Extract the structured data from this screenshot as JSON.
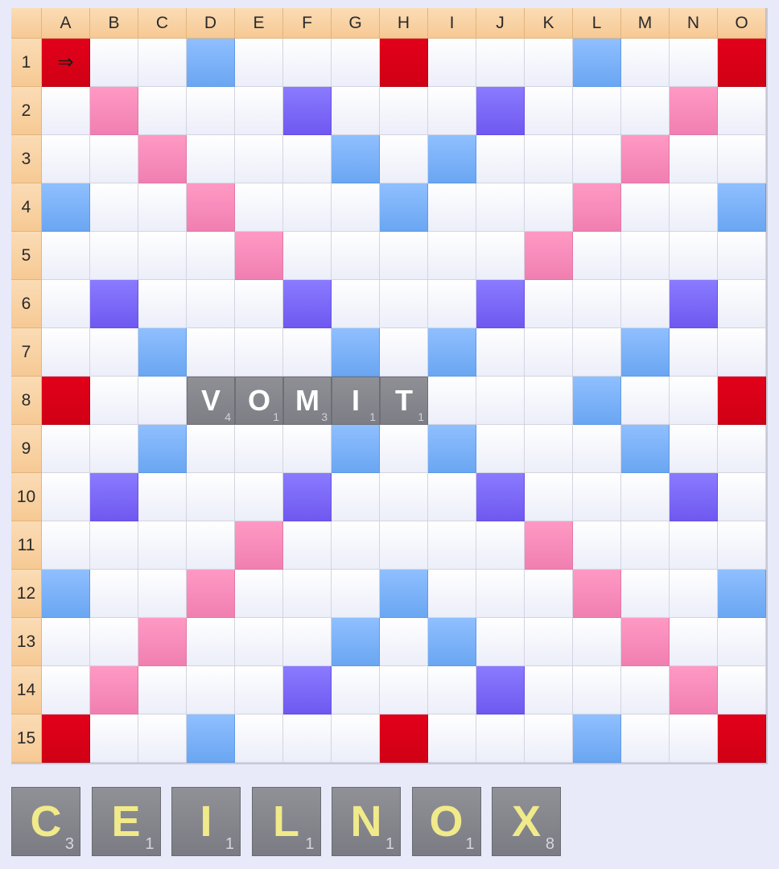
{
  "board": {
    "columns": [
      "A",
      "B",
      "C",
      "D",
      "E",
      "F",
      "G",
      "H",
      "I",
      "J",
      "K",
      "L",
      "M",
      "N",
      "O"
    ],
    "rows": [
      "1",
      "2",
      "3",
      "4",
      "5",
      "6",
      "7",
      "8",
      "9",
      "10",
      "11",
      "12",
      "13",
      "14",
      "15"
    ],
    "premium": [
      "TW . . DL . . . TW . . . DL . . TW",
      ". DW . . . TL . . . TL . . . DW .",
      ". . DW . . . DL . DL . . . DW . .",
      "DL . . DW . . . DL . . . DW . . DL",
      ". . . . DW . . . . . DW . . . .",
      ". TL . . . TL . . . TL . . . TL .",
      ". . DL . . . DL . DL . . . DL . .",
      "TW . . . . . . . . . . DL . . TW",
      ". . DL . . . DL . DL . . . DL . .",
      ". TL . . . TL . . . TL . . . TL .",
      ". . . . DW . . . . . DW . . . .",
      "DL . . DW . . . DL . . . DW . . DL",
      ". . DW . . . DL . DL . . . DW . .",
      ". DW . . . TL . . . TL . . . DW .",
      "TW . . DL . . . TW . . . DL . . TW"
    ],
    "placed_tiles": [
      {
        "row": 8,
        "col": 4,
        "letter": "V",
        "points": "4"
      },
      {
        "row": 8,
        "col": 5,
        "letter": "O",
        "points": "1"
      },
      {
        "row": 8,
        "col": 6,
        "letter": "M",
        "points": "3"
      },
      {
        "row": 8,
        "col": 7,
        "letter": "I",
        "points": "1"
      },
      {
        "row": 8,
        "col": 8,
        "letter": "T",
        "points": "1"
      }
    ],
    "cursor": {
      "row": 1,
      "col": 1,
      "direction_icon": "arrow-right-icon",
      "glyph": "⇒"
    }
  },
  "rack": [
    {
      "letter": "C",
      "points": "3"
    },
    {
      "letter": "E",
      "points": "1"
    },
    {
      "letter": "I",
      "points": "1"
    },
    {
      "letter": "L",
      "points": "1"
    },
    {
      "letter": "N",
      "points": "1"
    },
    {
      "letter": "O",
      "points": "1"
    },
    {
      "letter": "X",
      "points": "8"
    }
  ],
  "colors": {
    "triple_word": "#e2001a",
    "double_word": "#f590bd",
    "triple_letter": "#7e6cf8",
    "double_letter": "#80b4f9",
    "board_tile": "#86878d",
    "rack_letter": "#f1ea8a",
    "background": "#e8eafa"
  }
}
